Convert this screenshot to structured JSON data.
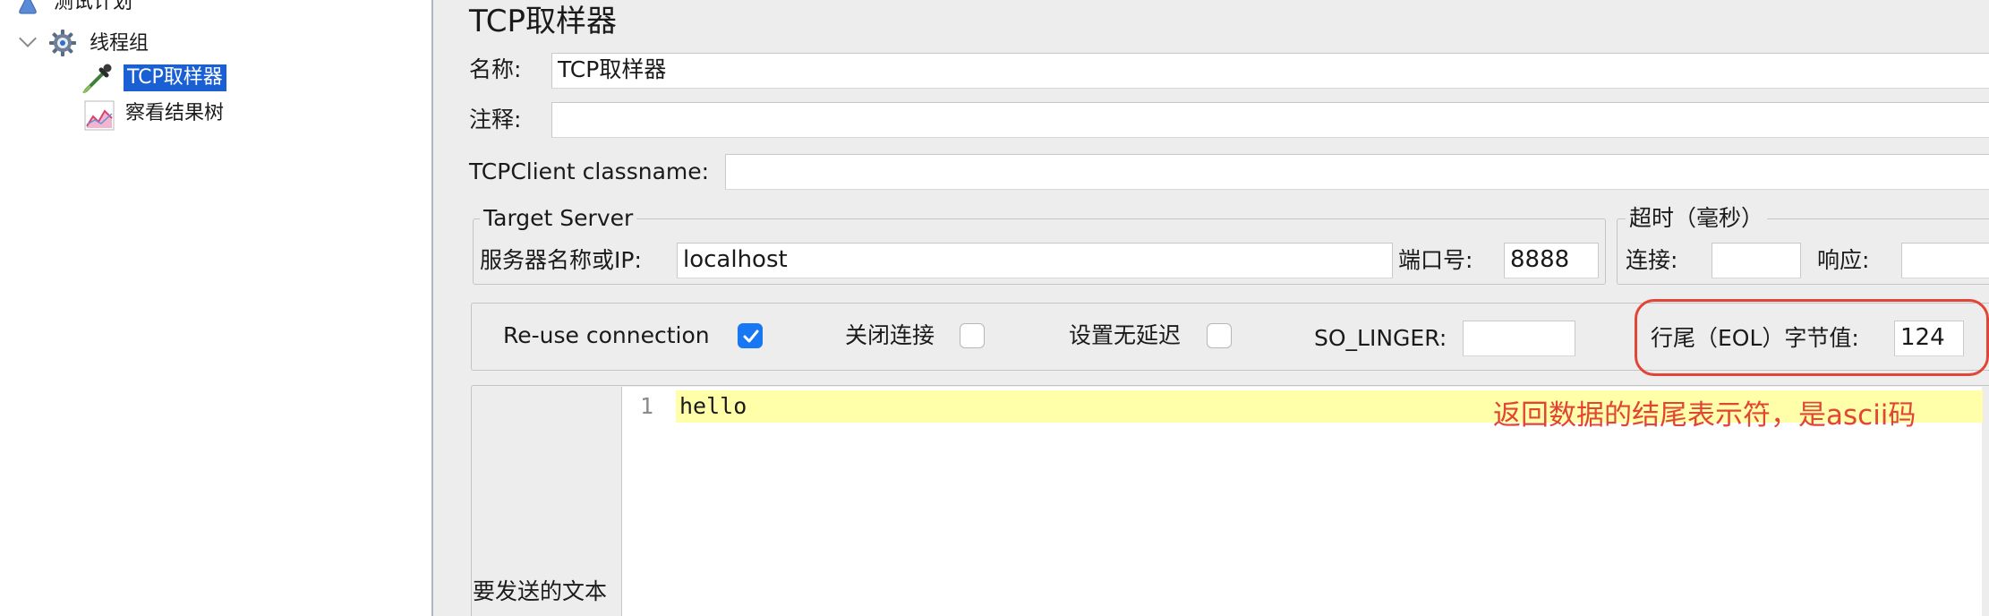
{
  "tree": {
    "items": [
      {
        "label": "测试计划"
      },
      {
        "label": "线程组"
      },
      {
        "label": "TCP取样器"
      },
      {
        "label": "察看结果树"
      }
    ]
  },
  "main": {
    "title": "TCP取样器",
    "name_label": "名称:",
    "name_value": "TCP取样器",
    "comment_label": "注释:",
    "comment_value": "",
    "classname_label": "TCPClient classname:",
    "classname_value": "",
    "target_server": {
      "legend": "Target Server",
      "server_label": "服务器名称或IP:",
      "server_value": "localhost",
      "port_label": "端口号:",
      "port_value": "8888"
    },
    "timeout": {
      "legend": "超时（毫秒）",
      "connect_label": "连接:",
      "connect_value": "",
      "response_label": "响应:",
      "response_value": ""
    },
    "options": {
      "reuse_label": "Re-use connection",
      "reuse_checked": true,
      "close_label": "关闭连接",
      "close_checked": false,
      "nodelay_label": "设置无延迟",
      "nodelay_checked": false,
      "linger_label": "SO_LINGER:",
      "linger_value": "",
      "eol_label": "行尾（EOL）字节值:",
      "eol_value": "124"
    },
    "text_to_send": {
      "label": "要发送的文本",
      "line_number": "1",
      "content": "hello"
    }
  },
  "annotation": {
    "text": "返回数据的结尾表示符，是ascii码",
    "color": "#e24535"
  },
  "colors": {
    "selection": "#1a5fd3",
    "checkbox_accent": "#1877f2",
    "editor_highlight": "#ffffaa"
  }
}
